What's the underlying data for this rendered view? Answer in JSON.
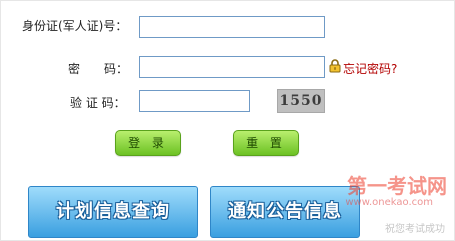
{
  "form": {
    "id_label": "身份证(军人证)号：",
    "password_label": "密　　码：",
    "captcha_label": "验 证 码：",
    "forgot_password": "忘记密码?",
    "captcha_code": "1550"
  },
  "buttons": {
    "login": "登 录",
    "reset": "重 置",
    "plan_query": "计划信息查询",
    "notice_info": "通知公告信息"
  },
  "watermark": {
    "name": "第一考试网",
    "url": "www.onekao.com",
    "slogan": "祝您考试成功"
  },
  "colors": {
    "field_border": "#6f9ac6",
    "forgot_link": "#b30000",
    "button_green": "#6cc123",
    "button_blue": "#3a9fe0"
  }
}
